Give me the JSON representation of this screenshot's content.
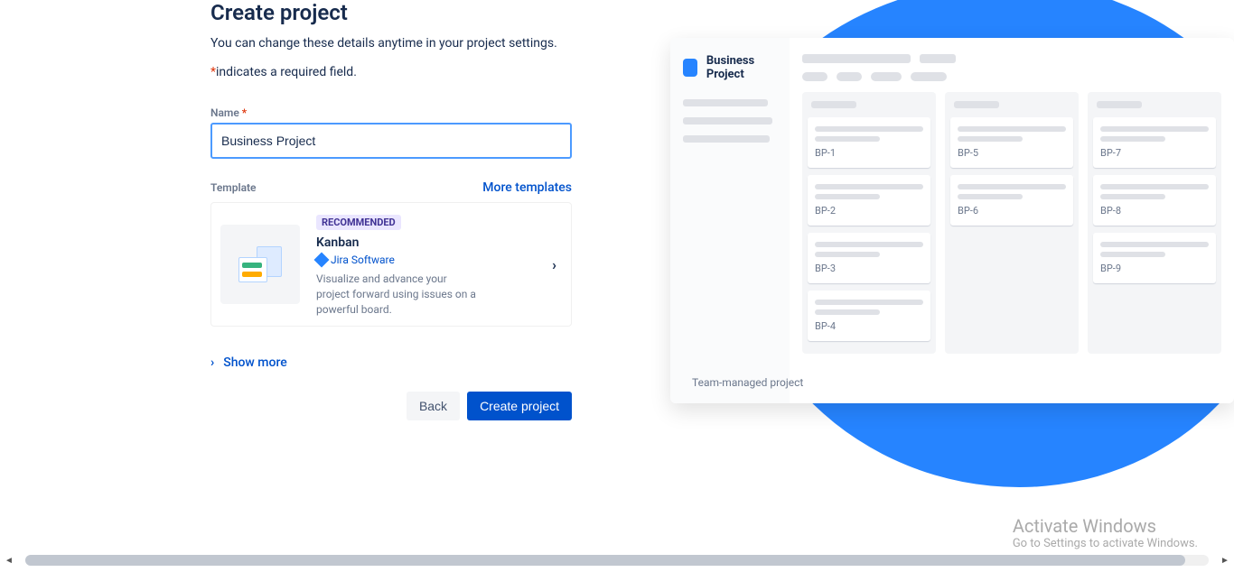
{
  "page": {
    "title": "Create project",
    "subtitle": "You can change these details anytime in your project settings.",
    "required_note": "indicates a required field."
  },
  "form": {
    "name_label": "Name",
    "name_value": "Business Project",
    "template_label": "Template",
    "more_templates": "More templates"
  },
  "template": {
    "badge": "RECOMMENDED",
    "name": "Kanban",
    "software": "Jira Software",
    "description": "Visualize and advance your project forward using issues on a powerful board."
  },
  "actions": {
    "show_more": "Show more",
    "back": "Back",
    "create": "Create project"
  },
  "preview": {
    "project_name": "Business Project",
    "team_managed": "Team-managed project",
    "columns": [
      {
        "cards": [
          "BP-1",
          "BP-2",
          "BP-3",
          "BP-4"
        ]
      },
      {
        "cards": [
          "BP-5",
          "BP-6"
        ]
      },
      {
        "cards": [
          "BP-7",
          "BP-8",
          "BP-9"
        ]
      }
    ]
  },
  "watermark": {
    "line1": "Activate Windows",
    "line2": "Go to Settings to activate Windows."
  }
}
